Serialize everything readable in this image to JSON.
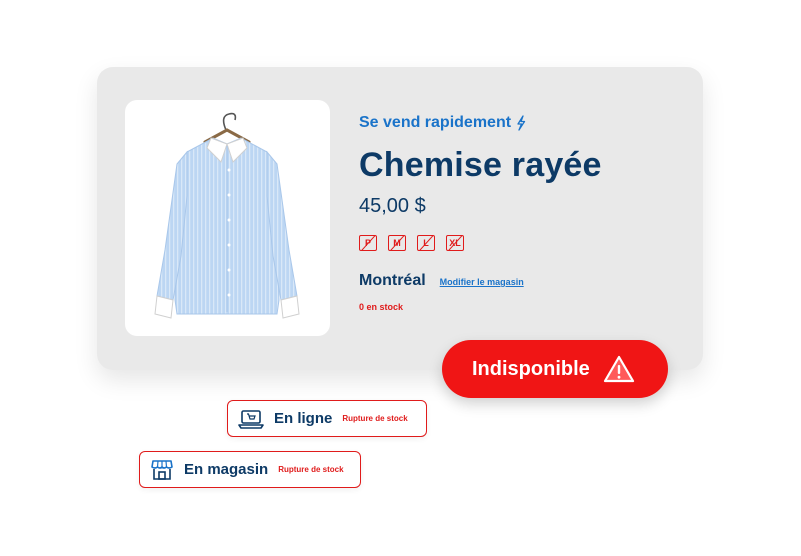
{
  "product": {
    "tagline": "Se vend rapidement",
    "tagline_icon": "lightning-icon",
    "title": "Chemise rayée",
    "price": "45,00 $",
    "sizes": [
      "P",
      "M",
      "L",
      "XL"
    ],
    "store_name": "Montréal",
    "change_store_label": "Modifier le magasin",
    "stock_text": "0 en stock",
    "image_icon": "shirt-image"
  },
  "availability": {
    "label": "Indisponible",
    "icon": "warning-icon"
  },
  "channels": [
    {
      "label": "En ligne",
      "status": "Rupture de stock",
      "icon": "laptop-cart-icon"
    },
    {
      "label": "En magasin",
      "status": "Rupture de stock",
      "icon": "storefront-icon"
    }
  ],
  "colors": {
    "navy": "#0d3a66",
    "blue": "#1a73c9",
    "red": "#e01b1b",
    "card_bg": "#e9e9e9"
  }
}
